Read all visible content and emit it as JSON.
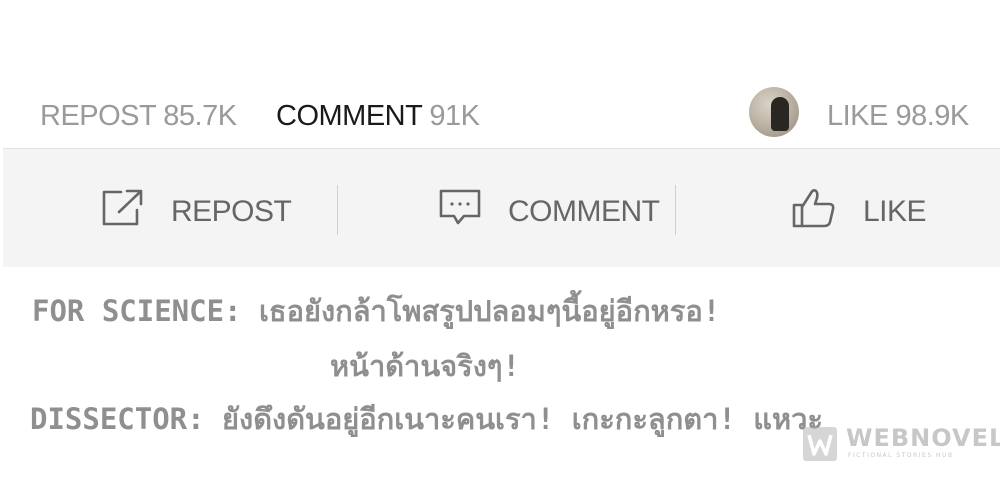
{
  "stats": {
    "repost_label": "REPOST",
    "repost_count": "85.7K",
    "comment_label": "COMMENT",
    "comment_count": "91K",
    "like_label": "LIKE",
    "like_count": "98.9K"
  },
  "actions": {
    "repost_label": "REPOST",
    "comment_label": "COMMENT",
    "like_label": "LIKE"
  },
  "captions": {
    "line1": "FOR SCIENCE: เธอยังกล้าโพสรูปปลอมๆนี้อยู่อีกหรอ!",
    "line2": "หน้าด้านจริงๆ!",
    "line3": "DISSECTOR: ยังดึงดันอยู่อีกเนาะคนเรา! เกะกะลูกตา! แหวะ"
  },
  "watermark": {
    "name": "WEBNOVEL",
    "tagline": "FICTIONAL STORIES HUB"
  },
  "colors": {
    "muted_text": "#9a9a9a",
    "active_text": "#1a1a1a",
    "action_bar_bg": "#f4f4f4",
    "icon": "#666666"
  }
}
